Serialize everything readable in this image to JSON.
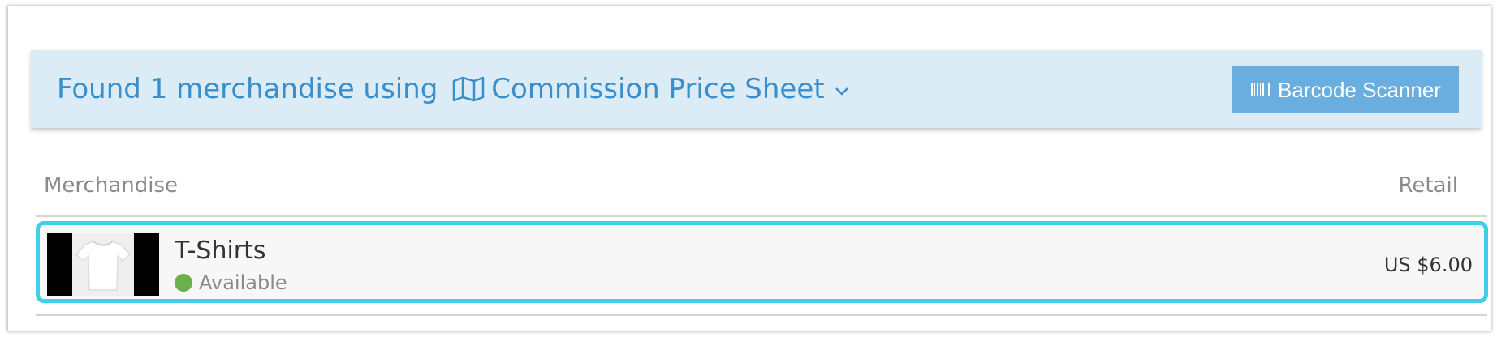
{
  "banner": {
    "found_text": "Found 1 merchandise using",
    "price_sheet_label": "Commission Price Sheet",
    "price_sheet_icon": "map-icon",
    "dropdown_icon": "chevron-down-icon",
    "scanner_label": "Barcode Scanner",
    "scanner_icon": "barcode-icon",
    "background_color": "#dcecf6",
    "text_color": "#3a8fcb",
    "button_color": "#6aaee0"
  },
  "table": {
    "columns": [
      "Merchandise",
      "Retail"
    ],
    "rows": [
      {
        "name": "T-Shirts",
        "status": "Available",
        "status_color": "#6ab04c",
        "retail": "US $6.00",
        "thumbnail": "t-shirt-image",
        "selected": true,
        "highlight_color": "#3fd0e8"
      }
    ]
  }
}
